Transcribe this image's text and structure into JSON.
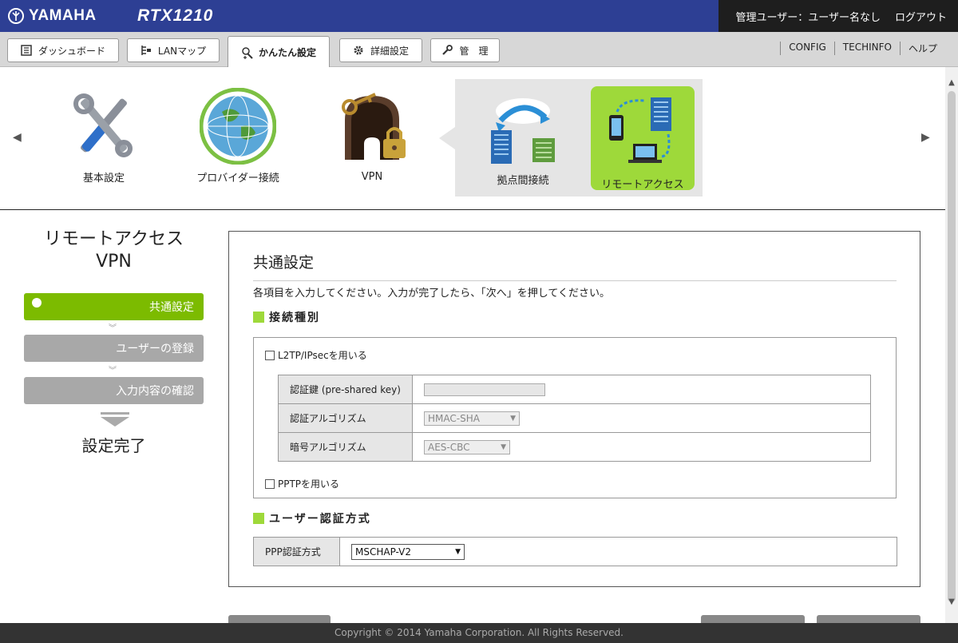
{
  "header": {
    "brand": "YAMAHA",
    "model": "RTX1210",
    "user_status": "管理ユーザー：ユーザー名なし",
    "logout": "ログアウト"
  },
  "tabs": [
    {
      "label": "ダッシュボード",
      "icon": "dashboard-icon"
    },
    {
      "label": "LANマップ",
      "icon": "lan-map-icon"
    },
    {
      "label": "かんたん設定",
      "icon": "wand-icon",
      "active": true
    },
    {
      "label": "詳細設定",
      "icon": "gear-icon"
    },
    {
      "label": "管　理",
      "icon": "wrench-icon"
    }
  ],
  "toplinks": [
    "CONFIG",
    "TECHINFO",
    "ヘルプ"
  ],
  "icon_row": {
    "items": [
      {
        "label": "基本設定",
        "icon": "tools-icon"
      },
      {
        "label": "プロバイダー接続",
        "icon": "globe-icon"
      },
      {
        "label": "VPN",
        "icon": "vpn-keys-icon"
      }
    ],
    "sub_items": [
      {
        "label": "拠点間接続",
        "icon": "site-to-site-icon"
      },
      {
        "label": "リモートアクセス",
        "icon": "remote-access-icon",
        "selected": true
      }
    ]
  },
  "wizard": {
    "title_line1": "リモートアクセス",
    "title_line2": "VPN",
    "steps": [
      "共通設定",
      "ユーザーの登録",
      "入力内容の確認"
    ],
    "done": "設定完了"
  },
  "panel": {
    "title": "共通設定",
    "description": "各項目を入力してください。入力が完了したら、「次へ」を押してください。",
    "section1": "接続種別",
    "l2tp_label": "L2TP/IPsecを用いる",
    "psk_label": "認証鍵 (pre-shared key)",
    "psk_value": "",
    "auth_alg_label": "認証アルゴリズム",
    "auth_alg_value": "HMAC-SHA",
    "enc_alg_label": "暗号アルゴリズム",
    "enc_alg_value": "AES-CBC",
    "pptp_label": "PPTPを用いる",
    "section2": "ユーザー認証方式",
    "ppp_auth_label": "PPP認証方式",
    "ppp_auth_value": "MSCHAP-V2"
  },
  "footer": "Copyright © 2014 Yamaha Corporation. All Rights Reserved.",
  "colors": {
    "header": "#2d3f94",
    "accent_green": "#9ed93a",
    "step_active": "#7cbb00"
  }
}
